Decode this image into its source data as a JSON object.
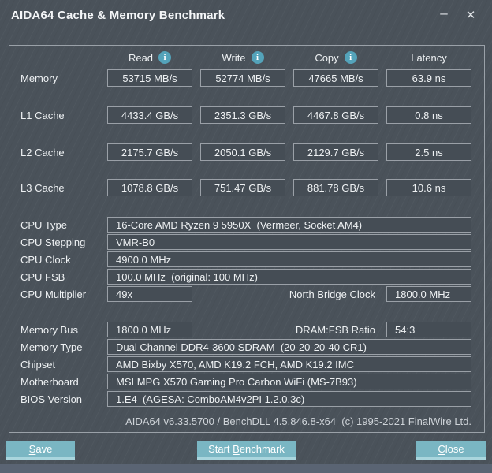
{
  "window": {
    "title": "AIDA64 Cache & Memory Benchmark"
  },
  "titlebar": {
    "minimize_glyph": "–",
    "close_glyph": "✕"
  },
  "benchmark": {
    "info_glyph": "i",
    "columns": [
      {
        "label": "Read"
      },
      {
        "label": "Write"
      },
      {
        "label": "Copy"
      },
      {
        "label": "Latency"
      }
    ],
    "rows": [
      {
        "label": "Memory",
        "values": [
          "53715 MB/s",
          "52774 MB/s",
          "47665 MB/s",
          "63.9 ns"
        ]
      },
      {
        "label": "L1 Cache",
        "values": [
          "4433.4 GB/s",
          "2351.3 GB/s",
          "4467.8 GB/s",
          "0.8 ns"
        ]
      },
      {
        "label": "L2 Cache",
        "values": [
          "2175.7 GB/s",
          "2050.1 GB/s",
          "2129.7 GB/s",
          "2.5 ns"
        ]
      },
      {
        "label": "L3 Cache",
        "values": [
          "1078.8 GB/s",
          "751.47 GB/s",
          "881.78 GB/s",
          "10.6 ns"
        ]
      }
    ]
  },
  "system": {
    "cpu_type": {
      "label": "CPU Type",
      "value": "16-Core AMD Ryzen 9 5950X  (Vermeer, Socket AM4)"
    },
    "cpu_stepping": {
      "label": "CPU Stepping",
      "value": "VMR-B0"
    },
    "cpu_clock": {
      "label": "CPU Clock",
      "value": "4900.0 MHz"
    },
    "cpu_fsb": {
      "label": "CPU FSB",
      "value": "100.0 MHz  (original: 100 MHz)"
    },
    "cpu_multiplier": {
      "label": "CPU Multiplier",
      "value": "49x",
      "right_label": "North Bridge Clock",
      "right_value": "1800.0 MHz"
    },
    "memory_bus": {
      "label": "Memory Bus",
      "value": "1800.0 MHz",
      "right_label": "DRAM:FSB Ratio",
      "right_value": "54:3"
    },
    "memory_type": {
      "label": "Memory Type",
      "value": "Dual Channel DDR4-3600 SDRAM  (20-20-20-40 CR1)"
    },
    "chipset": {
      "label": "Chipset",
      "value": "AMD Bixby X570, AMD K19.2 FCH, AMD K19.2 IMC"
    },
    "motherboard": {
      "label": "Motherboard",
      "value": "MSI MPG X570 Gaming Pro Carbon WiFi (MS-7B93)"
    },
    "bios_version": {
      "label": "BIOS Version",
      "value": "1.E4  (AGESA: ComboAM4v2PI 1.2.0.3c)"
    }
  },
  "footer": {
    "version_line": "AIDA64 v6.33.5700 / BenchDLL 4.5.846.8-x64  (c) 1995-2021 FinalWire Ltd."
  },
  "buttons": {
    "save": {
      "pre": "",
      "key": "S",
      "post": "ave"
    },
    "start_benchmark": {
      "pre": "Start ",
      "key": "B",
      "post": "enchmark"
    },
    "close": {
      "pre": "",
      "key": "C",
      "post": "lose"
    }
  },
  "colors": {
    "background": "#4a525a",
    "box_border": "#9aa0a7",
    "box_fill": "#454d55",
    "accent_teal": "#7ab6c3",
    "button_bottom_band": "#a9d5dd",
    "info_icon": "#54a3ba",
    "bottom_strip": "#5a6473"
  }
}
